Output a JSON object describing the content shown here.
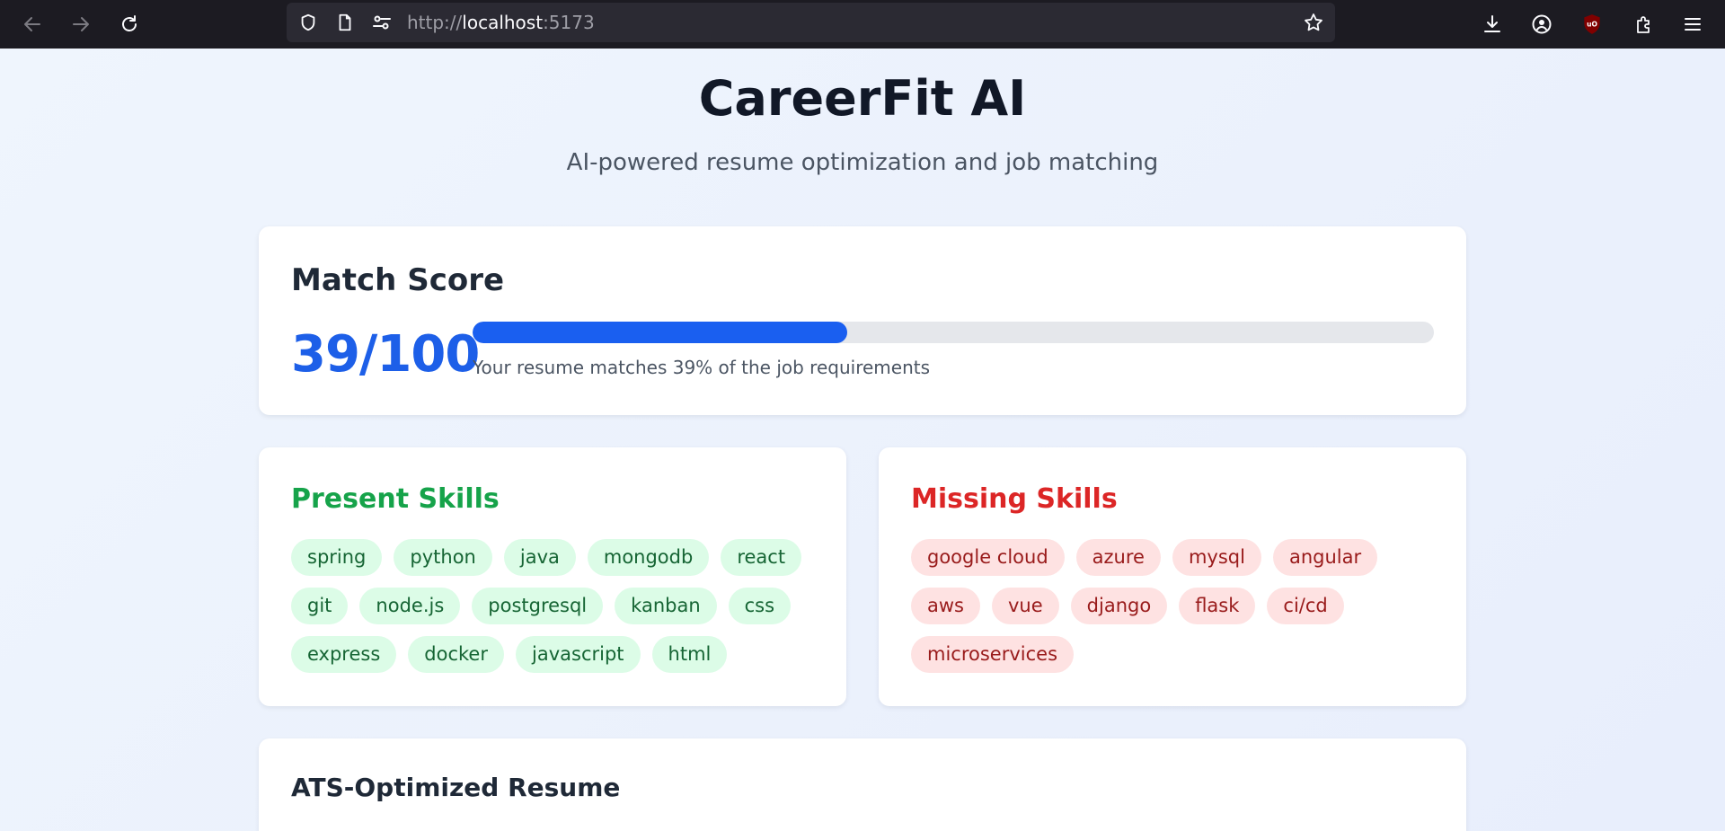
{
  "browser": {
    "url_host": "http://localhost",
    "url_port": ":5173"
  },
  "header": {
    "title": "CareerFit AI",
    "subtitle": "AI-powered resume optimization and job matching"
  },
  "match": {
    "heading": "Match Score",
    "score_text": "39/100",
    "score_percent": 39,
    "caption": "Your resume matches 39% of the job requirements",
    "accent": "#1a5ff0"
  },
  "present_skills": {
    "title": "Present Skills",
    "color": "#16a34a",
    "items": [
      "spring",
      "python",
      "java",
      "mongodb",
      "react",
      "git",
      "node.js",
      "postgresql",
      "kanban",
      "css",
      "express",
      "docker",
      "javascript",
      "html"
    ]
  },
  "missing_skills": {
    "title": "Missing Skills",
    "color": "#dc2626",
    "items": [
      "google cloud",
      "azure",
      "mysql",
      "angular",
      "aws",
      "vue",
      "django",
      "flask",
      "ci/cd",
      "microservices"
    ]
  },
  "ats": {
    "heading": "ATS-Optimized Resume"
  }
}
